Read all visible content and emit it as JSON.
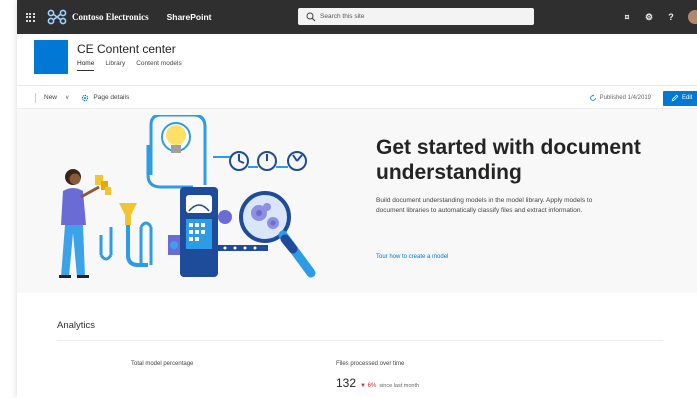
{
  "suite_bar": {
    "brand": "Contoso Electronics",
    "app": "SharePoint",
    "search_placeholder": "Search this site",
    "icons": [
      "waffle-icon",
      "contoso-logo",
      "search-icon",
      "help-icon",
      "settings-icon",
      "question-icon",
      "avatar"
    ],
    "bell_glyph": "¤",
    "settings_glyph": "⚙",
    "help_glyph": "?"
  },
  "site": {
    "title": "CE Content center",
    "nav": [
      {
        "label": "Home",
        "active": true
      },
      {
        "label": "Library",
        "active": false
      },
      {
        "label": "Content models",
        "active": false
      }
    ],
    "logo_color": "#0078d4"
  },
  "command_bar": {
    "new_label": "New",
    "chevron": "∨",
    "page_details_label": "Page details",
    "published_label": "Published 1/4/2019",
    "edit_label": "Edit"
  },
  "hero": {
    "title": "Get started with document understanding",
    "description": "Build document understanding models in the model library. Apply models to document libraries to automatically classify files and extract information.",
    "link_text": "Tour how to create a model"
  },
  "analytics": {
    "title": "Analytics",
    "metric1_label": "Total model percentage",
    "metric2_label": "Files processed over time",
    "metric2_value": "132",
    "metric2_trend": "▼ 6%",
    "metric2_trend_note": "since last month"
  },
  "colors": {
    "accent": "#0078d4",
    "suite_bar": "#2f2f2f",
    "trend_down": "#d13438"
  }
}
